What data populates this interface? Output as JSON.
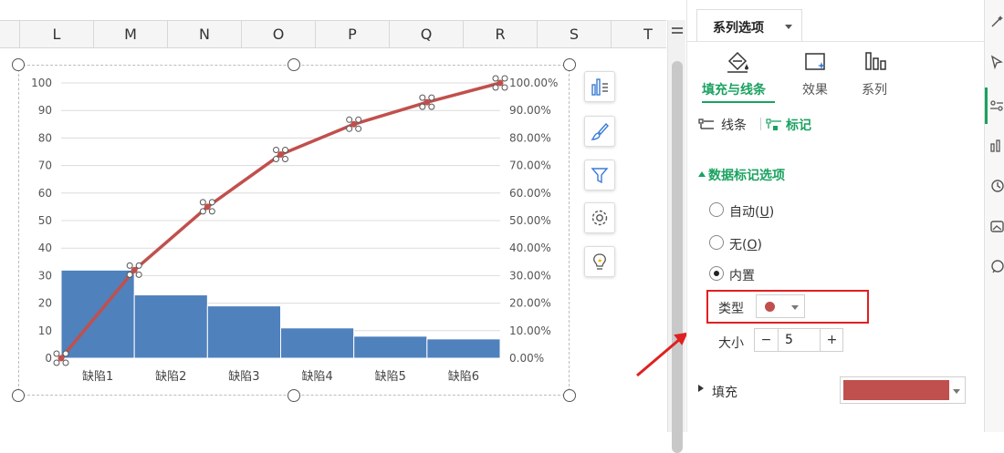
{
  "columns": [
    "L",
    "M",
    "N",
    "O",
    "P",
    "Q",
    "R",
    "S",
    "T"
  ],
  "chart_data": {
    "type": "bar",
    "categories": [
      "缺陷1",
      "缺陷2",
      "缺陷3",
      "缺陷4",
      "缺陷5",
      "缺陷6"
    ],
    "series": [
      {
        "type": "bar",
        "values": [
          32,
          23,
          19,
          11,
          8,
          7
        ],
        "color": "#4f81bd"
      },
      {
        "type": "line",
        "axis": "secondary",
        "x": [
          0,
          1,
          2,
          3,
          4,
          5,
          6
        ],
        "values": [
          0,
          32,
          55,
          74,
          85,
          93,
          100
        ],
        "color": "#c0504d"
      }
    ],
    "y_ticks": [
      "0",
      "10",
      "20",
      "30",
      "40",
      "50",
      "60",
      "70",
      "80",
      "90",
      "100"
    ],
    "y2_ticks": [
      "0.00%",
      "10.00%",
      "20.00%",
      "30.00%",
      "40.00%",
      "50.00%",
      "60.00%",
      "70.00%",
      "80.00%",
      "90.00%",
      "100.00%"
    ],
    "ylim": [
      0,
      100
    ],
    "y2lim": [
      0,
      1
    ],
    "grid": true
  },
  "chart_tools": [
    "chart-elements-icon",
    "chart-style-icon",
    "chart-filter-icon",
    "chart-settings-icon",
    "chart-ideas-icon"
  ],
  "panel": {
    "tab_title": "系列选项",
    "subtabs": [
      "填充与线条",
      "效果",
      "系列"
    ],
    "subtab_active": "填充与线条",
    "line_label": "线条",
    "marker_label": "标记",
    "section_title": "数据标记选项",
    "options": [
      {
        "label": "自动(",
        "key": "U",
        "tail": ")",
        "checked": false
      },
      {
        "label": "无(",
        "key": "O",
        "tail": ")",
        "checked": false
      },
      {
        "label": "内置",
        "key": "",
        "tail": "",
        "checked": true
      }
    ],
    "type_label": "类型",
    "type_value_color": "#c0504d",
    "size_label": "大小",
    "size_minus": "−",
    "size_value": "5",
    "size_plus": "+",
    "fill_label": "填充",
    "fill_color": "#c0504d",
    "accent_color": "#1aa260",
    "highlight_color": "#e02020"
  }
}
